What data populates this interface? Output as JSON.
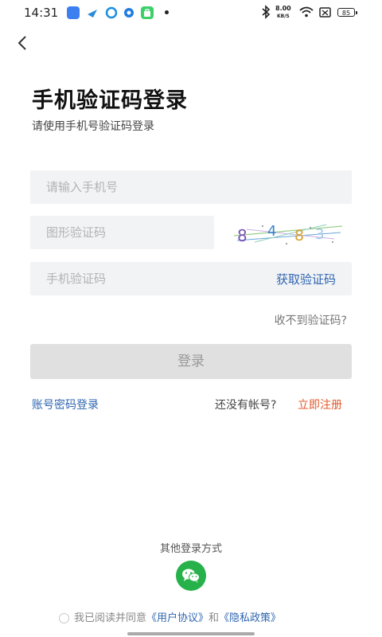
{
  "status_bar": {
    "time": "14:31",
    "net_speed_value": "8.00",
    "net_speed_unit": "KB/S",
    "battery": "85",
    "icons": [
      "bluetooth-icon",
      "wifi-icon",
      "sim-icon",
      "battery-icon"
    ]
  },
  "header": {
    "title": "手机验证码登录",
    "subtitle": "请使用手机号验证码登录"
  },
  "form": {
    "phone_placeholder": "请输入手机号",
    "captcha_placeholder": "图形验证码",
    "captcha_image_text": "8483",
    "sms_placeholder": "手机验证码",
    "get_code_label": "获取验证码",
    "no_code_label": "收不到验证码?",
    "login_label": "登录"
  },
  "links": {
    "password_login": "账号密码登录",
    "no_account": "还没有帐号?",
    "register": "立即注册"
  },
  "other_login": {
    "label": "其他登录方式",
    "wechat_icon": "wechat-icon"
  },
  "agreement": {
    "prefix": "我已阅读并同意",
    "user_agreement": "《用户协议》",
    "and": "和",
    "privacy_policy": "《隐私政策》"
  },
  "colors": {
    "accent_blue": "#2f66b0",
    "register_orange": "#e2592b",
    "wechat_green": "#27b14a",
    "disabled_button": "#e0e0e0"
  }
}
